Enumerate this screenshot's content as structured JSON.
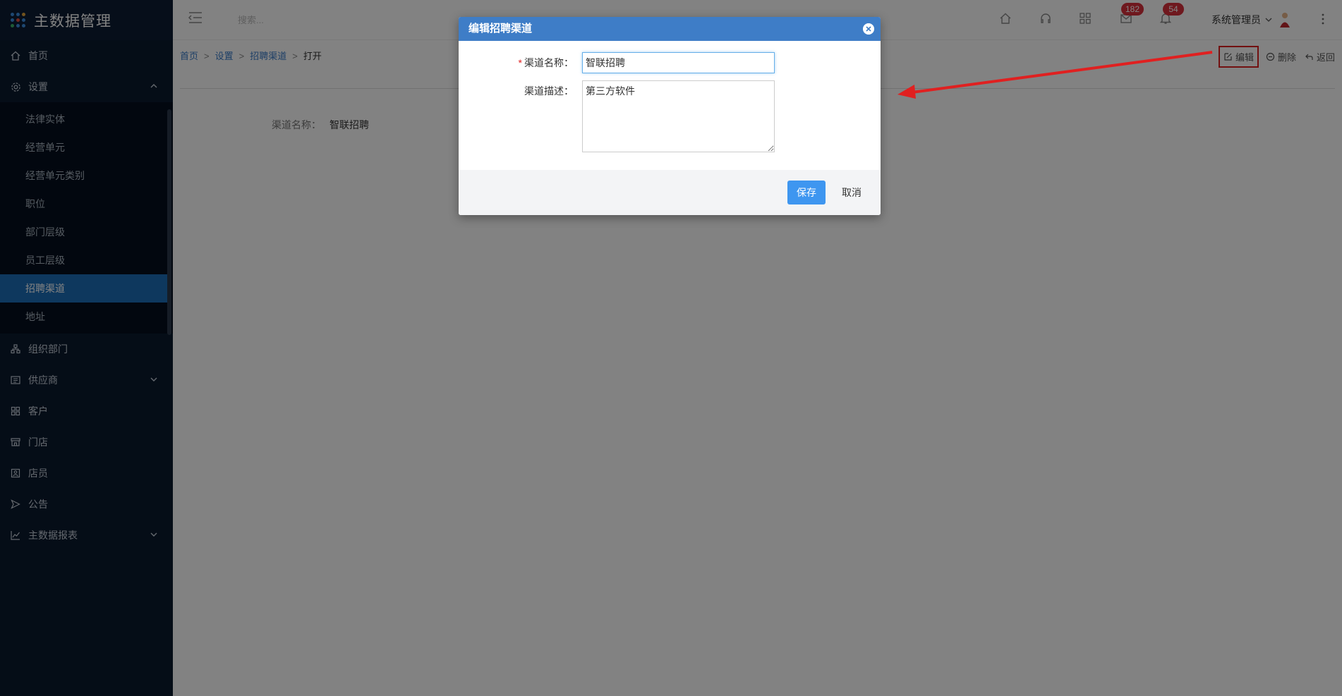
{
  "app": {
    "title": "主数据管理"
  },
  "colors": {
    "sidebar_bg": "#0a1a2e",
    "active": "#1d6fb8",
    "modal_header": "#3e7dc7",
    "primary_button": "#3e96f0",
    "badge": "#d9303b",
    "annotation": "#e02020"
  },
  "sidebar": {
    "items": [
      {
        "label": "首页",
        "icon": "home-icon"
      },
      {
        "label": "设置",
        "icon": "gear-icon",
        "expanded": true
      },
      {
        "label": "组织部门",
        "icon": "org-tree-icon"
      },
      {
        "label": "供应商",
        "icon": "supplier-icon"
      },
      {
        "label": "客户",
        "icon": "customer-icon"
      },
      {
        "label": "门店",
        "icon": "store-icon"
      },
      {
        "label": "店员",
        "icon": "clerk-icon"
      },
      {
        "label": "公告",
        "icon": "announcement-icon"
      },
      {
        "label": "主数据报表",
        "icon": "chart-icon"
      }
    ],
    "settings_sub": [
      "法律实体",
      "经营单元",
      "经营单元类别",
      "职位",
      "部门层级",
      "员工层级",
      "招聘渠道",
      "地址"
    ],
    "active_sub": "招聘渠道"
  },
  "topbar": {
    "search_placeholder": "搜索...",
    "badge_messages": "182",
    "badge_notifications": "54",
    "user_name": "系统管理员"
  },
  "breadcrumb": {
    "home": "首页",
    "settings": "设置",
    "channel": "招聘渠道",
    "current": "打开",
    "sep": ">"
  },
  "actions": {
    "edit": "编辑",
    "delete": "删除",
    "back": "返回"
  },
  "detail": {
    "name_label": "渠道名称：",
    "name_value": "智联招聘"
  },
  "modal": {
    "title": "编辑招聘渠道",
    "name_label": "渠道名称：",
    "required_mark": "*",
    "name_value": "智联招聘",
    "desc_label": "渠道描述：",
    "desc_value": "第三方软件",
    "save": "保存",
    "cancel": "取消"
  }
}
